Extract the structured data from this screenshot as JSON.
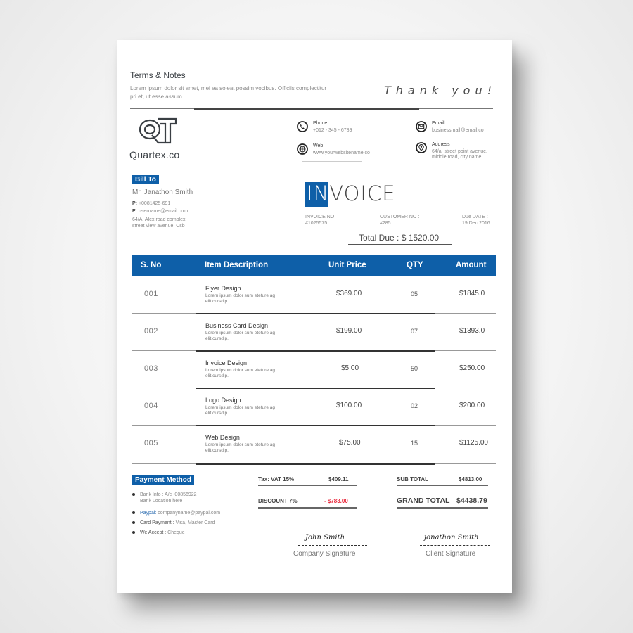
{
  "terms": {
    "title": "Terms & Notes",
    "text": "Lorem ipsum dolor sit amet, mei ea soleat possim vocibus. Officiis complectitur pri et, ut esse assum."
  },
  "thank_you": "Thank you!",
  "brand": {
    "name": "Quartex.co",
    "logo_icon": "qt-monogram-logo"
  },
  "contacts": [
    {
      "icon": "phone-icon",
      "label": "Phone",
      "value": "+012 - 345 - 6789"
    },
    {
      "icon": "globe-icon",
      "label": "Web",
      "value": "www.yourwebsitename.co"
    },
    {
      "icon": "mail-icon",
      "label": "Email",
      "value": "businessmail@email.co"
    },
    {
      "icon": "location-pin-icon",
      "label": "Address",
      "value_line1": "64/a, street point avenue,",
      "value_line2": "middle road, city name"
    }
  ],
  "bill_to": {
    "badge": "Bill To",
    "name": "Mr. Janathon Smith",
    "phone_label": "P:",
    "phone": "+0081425-691",
    "email_label": "E:",
    "email": "username@email.com",
    "address_line1": "64/A, Alex road complex,",
    "address_line2": "street view avenue, Csb"
  },
  "invoice": {
    "title_highlight": "IN",
    "title_rest": "VOICE",
    "invoice_no_label": "INVOICE NO",
    "invoice_no": "#1025575",
    "customer_no_label": "CUSTOMER NO :",
    "customer_no": "#285",
    "due_date_label": "Due DATE  :",
    "due_date": "19 Dec 2016",
    "total_due": "Total Due : $ 1520.00"
  },
  "table": {
    "headers": [
      "S. No",
      "Item Description",
      "Unit Price",
      "QTY",
      "Amount"
    ],
    "rows": [
      {
        "sno": "001",
        "title": "Flyer Design",
        "desc": "Lorem ipsum dolor sum eteture ag elit.cursdip.",
        "price": "$369.00",
        "qty": "05",
        "amount": "$1845.0"
      },
      {
        "sno": "002",
        "title": "Business Card Design",
        "desc": "Lorem ipsum dolor sum eteture ag elit.cursdip.",
        "price": "$199.00",
        "qty": "07",
        "amount": "$1393.0"
      },
      {
        "sno": "003",
        "title": "Invoice Design",
        "desc": "Lorem ipsum dolor sum eteture ag elit.cursdip.",
        "price": "$5.00",
        "qty": "50",
        "amount": "$250.00"
      },
      {
        "sno": "004",
        "title": "Logo Design",
        "desc": "Lorem ipsum dolor sum eteture ag elit.cursdip.",
        "price": "$100.00",
        "qty": "02",
        "amount": "$200.00"
      },
      {
        "sno": "005",
        "title": "Web Design",
        "desc": "Lorem ipsum dolor sum eteture ag elit.cursdip.",
        "price": "$75.00",
        "qty": "15",
        "amount": "$1125.00"
      }
    ]
  },
  "payment": {
    "badge": "Payment Method",
    "items": [
      {
        "key": "Bank Info : ",
        "value": "A/c -00856922",
        "line2": "Bank Location here"
      },
      {
        "key": "Paypal: ",
        "value": "companyname@paypal.com"
      },
      {
        "key": "Card Payment : ",
        "value": "Visa, Master Card"
      },
      {
        "key": "We Accept : ",
        "value": "Cheque"
      }
    ]
  },
  "summary": {
    "tax_label": "Tax: VAT 15%",
    "tax_value": "$409.11",
    "discount_label": "DISCOUNT 7%",
    "discount_value": "- $783.00",
    "subtotal_label": "SUB TOTAL",
    "subtotal_value": "$4813.00",
    "grand_label": "GRAND TOTAL",
    "grand_value": "$4438.79"
  },
  "signatures": {
    "company_sig": "John Smith",
    "company_label": "Company Signature",
    "client_sig": "jonathon Smith",
    "client_label": "Client Signature"
  },
  "colors": {
    "accent": "#0e5fa8",
    "discount": "#e8273a",
    "text": "#444444"
  }
}
